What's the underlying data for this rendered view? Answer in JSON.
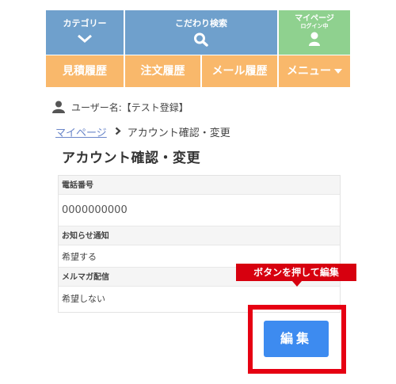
{
  "nav": {
    "category_label": "カテゴリー",
    "search_label": "こだわり検索",
    "mypage_label": "マイページ",
    "mypage_status": "ログイン中",
    "history_estimate": "見積履歴",
    "history_order": "注文履歴",
    "history_mail": "メール履歴",
    "menu_label": "メニュー"
  },
  "user": {
    "label": "ユーザー名:【テスト登録】"
  },
  "breadcrumb": {
    "home": "マイページ",
    "current": "アカウント確認・変更"
  },
  "page_title": "アカウント確認・変更",
  "fields": {
    "phone_label": "電話番号",
    "phone_value": "0000000000",
    "notice_label": "お知らせ通知",
    "notice_value": "希望する",
    "mailmag_label": "メルマガ配信",
    "mailmag_value": "希望しない"
  },
  "annotation": {
    "text": "ボタンを押して編集"
  },
  "edit_button": {
    "label": "編集"
  },
  "colors": {
    "nav_blue": "#6fa0cc",
    "nav_green": "#8fd18f",
    "nav_orange": "#f9b86b",
    "accent_red": "#d7000f",
    "button_blue": "#3d8bf0"
  }
}
